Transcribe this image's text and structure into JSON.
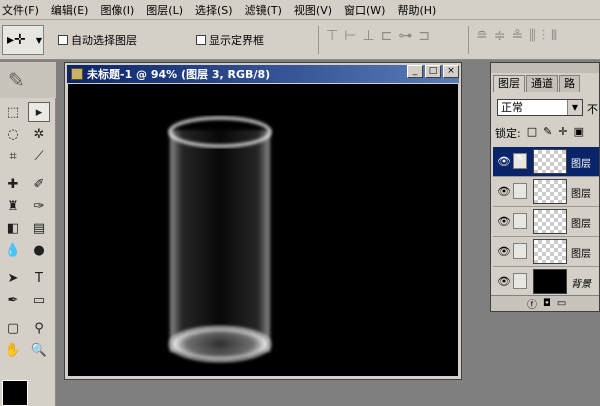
{
  "menu": [
    "文件(F)",
    "编辑(E)",
    "图像(I)",
    "图层(L)",
    "选择(S)",
    "滤镜(T)",
    "视图(V)",
    "窗口(W)",
    "帮助(H)"
  ],
  "options": {
    "auto_select": "自动选择图层",
    "show_bounds": "显示定界框"
  },
  "document": {
    "title": "未标题-1 @ 94% (图层 3, RGB/8)",
    "min": "_",
    "max": "□",
    "close": "×"
  },
  "layers_panel": {
    "tabs": [
      "图层",
      "通道",
      "路"
    ],
    "blend_mode": "正常",
    "opacity_label": "不",
    "lock_label": "锁定:",
    "layers": [
      {
        "name": "图层",
        "selected": true,
        "thumb": "transparent"
      },
      {
        "name": "图层",
        "selected": false,
        "thumb": "transparent"
      },
      {
        "name": "图层",
        "selected": false,
        "thumb": "transparent"
      },
      {
        "name": "图层",
        "selected": false,
        "thumb": "transparent"
      },
      {
        "name": "背景",
        "selected": false,
        "thumb": "black"
      }
    ]
  },
  "colors": {
    "titlebar": "#0a246a",
    "chrome": "#d4d0c8",
    "canvas": "#000000"
  }
}
